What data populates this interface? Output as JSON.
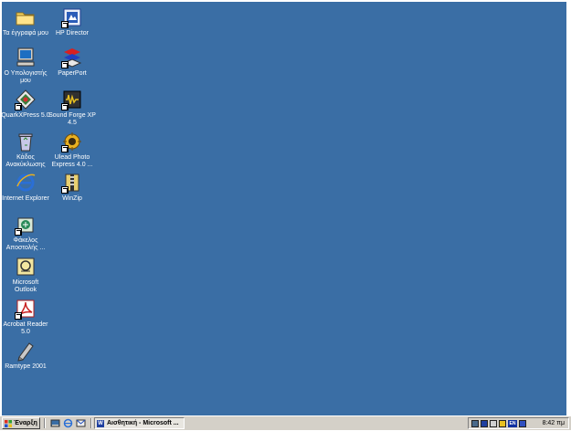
{
  "desktop": {
    "background": "#3a6ea5",
    "icons": [
      {
        "label": "Τα έγγραφά μου"
      },
      {
        "label": "Ο Υπολογιστής μου"
      },
      {
        "label": "QuarkXPress 5.0"
      },
      {
        "label": "Κάδος Ανακύκλωσης"
      },
      {
        "label": "Internet Explorer"
      },
      {
        "label": "Φάκελος Αποστολής ..."
      },
      {
        "label": "Microsoft Outlook"
      },
      {
        "label": "Acrobat Reader 5.0"
      },
      {
        "label": "Ramtype 2001"
      },
      {
        "label": "HP Director"
      },
      {
        "label": "PaperPort"
      },
      {
        "label": "Sound Forge XP 4.5"
      },
      {
        "label": "Ulead Photo Express 4.0 ..."
      },
      {
        "label": "WinZip"
      }
    ]
  },
  "taskbar": {
    "start_label": "Έναρξη",
    "quick_launch": [
      "show-desktop-icon",
      "internet-explorer-icon",
      "outlook-express-icon"
    ],
    "tasks": [
      {
        "label": "Αισθητική - Microsoft ..."
      }
    ],
    "tray": {
      "icons": [
        "network-icon",
        "mixer-icon",
        "speaker-icon",
        "display-icon",
        "language-icon",
        "antivirus-icon"
      ],
      "language": "EN",
      "clock": "8:42 πμ"
    }
  }
}
